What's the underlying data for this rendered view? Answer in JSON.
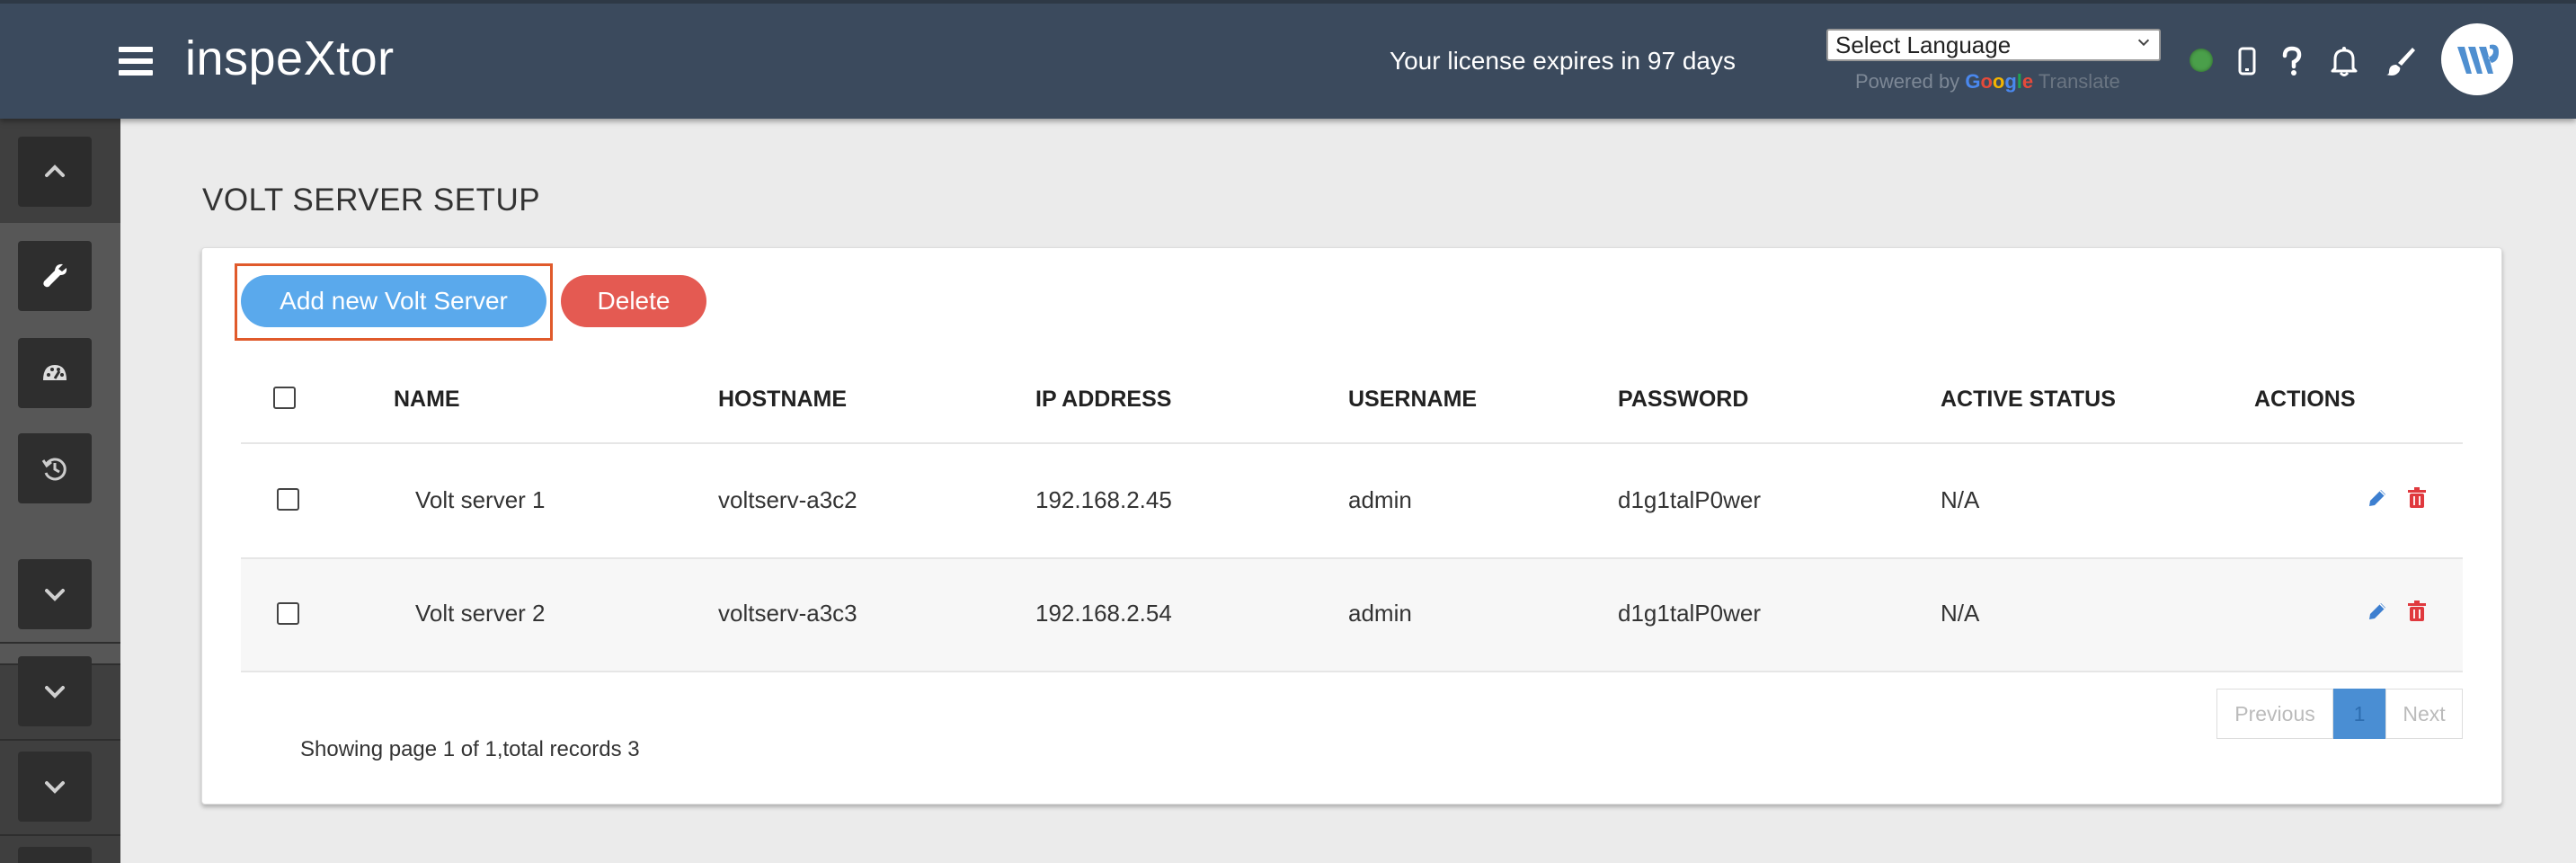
{
  "header": {
    "app_title": "inspeXtor",
    "license_text": "Your license expires in 97 days",
    "language_select": "Select Language",
    "powered_by": "Powered by",
    "google_letters": [
      "G",
      "o",
      "o",
      "g",
      "l",
      "e"
    ],
    "translate_word": "Translate",
    "status_color": "#4a9f4a",
    "icons": [
      "mobile-icon",
      "help-icon",
      "bell-icon",
      "brush-icon"
    ]
  },
  "sidebar": {
    "buttons": [
      "chevron-up-icon",
      "wrench-icon",
      "dashboard-icon",
      "history-icon",
      "chevron-down-icon",
      "chevron-down-icon",
      "chevron-down-icon"
    ]
  },
  "page": {
    "title": "VOLT SERVER SETUP"
  },
  "toolbar": {
    "add_label": "Add new Volt Server",
    "delete_label": "Delete"
  },
  "table": {
    "columns": [
      "NAME",
      "HOSTNAME",
      "IP ADDRESS",
      "USERNAME",
      "PASSWORD",
      "ACTIVE STATUS",
      "ACTIONS"
    ],
    "rows": [
      {
        "name": "Volt server 1",
        "hostname": "voltserv-a3c2",
        "ip": "192.168.2.45",
        "username": "admin",
        "password": "d1g1talP0wer",
        "status": "N/A"
      },
      {
        "name": "Volt server 2",
        "hostname": "voltserv-a3c3",
        "ip": "192.168.2.54",
        "username": "admin",
        "password": "d1g1talP0wer",
        "status": "N/A"
      }
    ]
  },
  "footer": {
    "summary": "Showing page 1 of 1,total records 3"
  },
  "pagination": {
    "previous": "Previous",
    "current": "1",
    "next": "Next"
  },
  "colors": {
    "header_bg": "#3b4a5d",
    "add_button": "#5aa9ec",
    "delete_button": "#e45a52",
    "edit_icon": "#3d7fd0",
    "delete_icon": "#e0393e",
    "highlight_border": "#e05a2b"
  }
}
